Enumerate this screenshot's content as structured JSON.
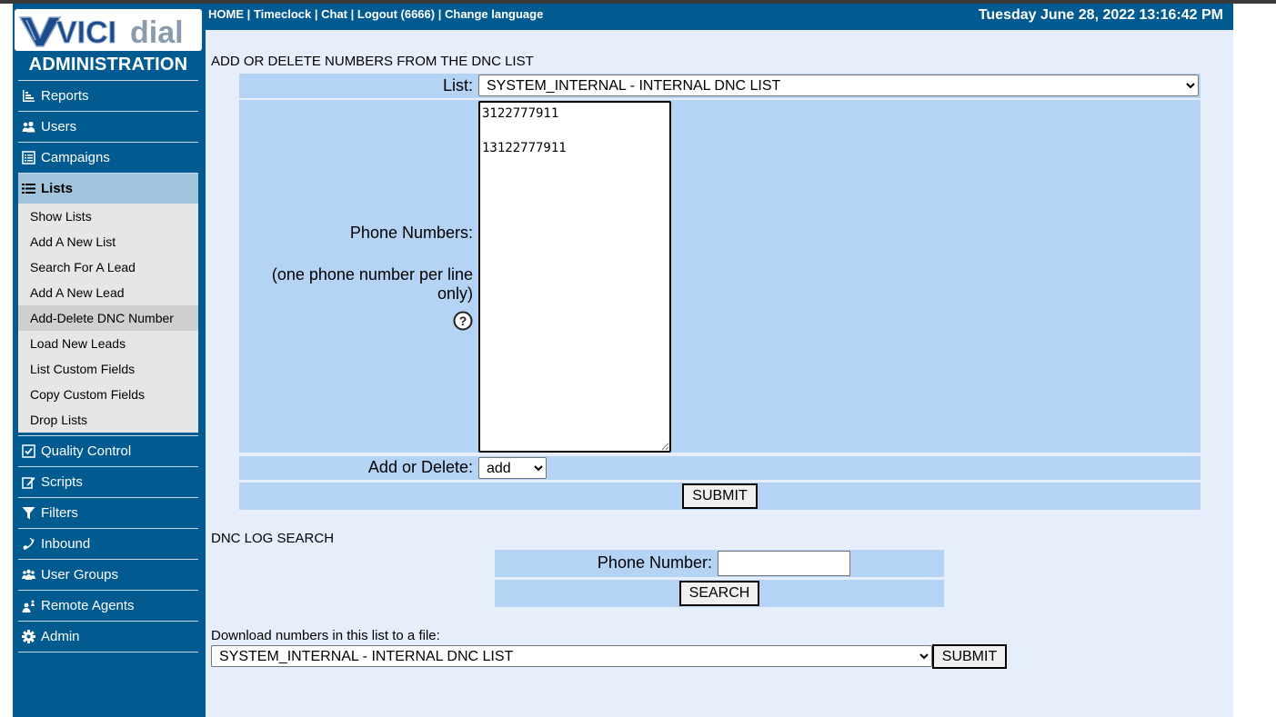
{
  "app": {
    "logo_text_vici": "VICI",
    "logo_text_dial": "dial",
    "section": "ADMINISTRATION"
  },
  "nav": {
    "items": [
      {
        "label": "Reports",
        "icon": "bar-chart-icon"
      },
      {
        "label": "Users",
        "icon": "users-icon"
      },
      {
        "label": "Campaigns",
        "icon": "campaign-list-icon"
      },
      {
        "label": "Lists",
        "icon": "list-icon",
        "active": true
      },
      {
        "label": "Quality Control",
        "icon": "checkbox-icon"
      },
      {
        "label": "Scripts",
        "icon": "edit-icon"
      },
      {
        "label": "Filters",
        "icon": "filter-icon"
      },
      {
        "label": "Inbound",
        "icon": "phone-icon"
      },
      {
        "label": "User Groups",
        "icon": "user-groups-icon"
      },
      {
        "label": "Remote Agents",
        "icon": "remote-agent-icon"
      },
      {
        "label": "Admin",
        "icon": "gear-icon"
      }
    ],
    "lists_sub": [
      "Show Lists",
      "Add A New List",
      "Search For A Lead",
      "Add A New Lead",
      "Add-Delete DNC Number",
      "Load New Leads",
      "List Custom Fields",
      "Copy Custom Fields",
      "Drop Lists"
    ],
    "selected_sub": "Add-Delete DNC Number"
  },
  "header": {
    "links": [
      "HOME",
      "Timeclock",
      "Chat",
      "Logout (6666)",
      "Change language"
    ],
    "separator": " | ",
    "datetime": "Tuesday June 28, 2022 13:16:42 PM"
  },
  "dnc_form": {
    "title": "ADD OR DELETE NUMBERS FROM THE DNC LIST",
    "list_label": "List:",
    "list_value": "SYSTEM_INTERNAL - INTERNAL DNC LIST",
    "phone_label": "Phone Numbers:",
    "phone_hint": "(one phone number per line only)",
    "phone_numbers": "3122777911\n\n13122777911",
    "add_delete_label": "Add or Delete:",
    "add_delete_value": "add",
    "submit_label": "SUBMIT"
  },
  "log_search": {
    "title": "DNC LOG SEARCH",
    "phone_label": "Phone Number:",
    "phone_value": "",
    "search_label": "SEARCH"
  },
  "download": {
    "label": "Download numbers in this list to a file:",
    "list_value": "SYSTEM_INTERNAL - INTERNAL DNC LIST",
    "submit_label": "SUBMIT"
  },
  "colors": {
    "sidebar": "#015b91",
    "page_bg": "#e6eefc",
    "row_bg": "#b5d3f5",
    "active_nav": "#9fc4dc"
  }
}
